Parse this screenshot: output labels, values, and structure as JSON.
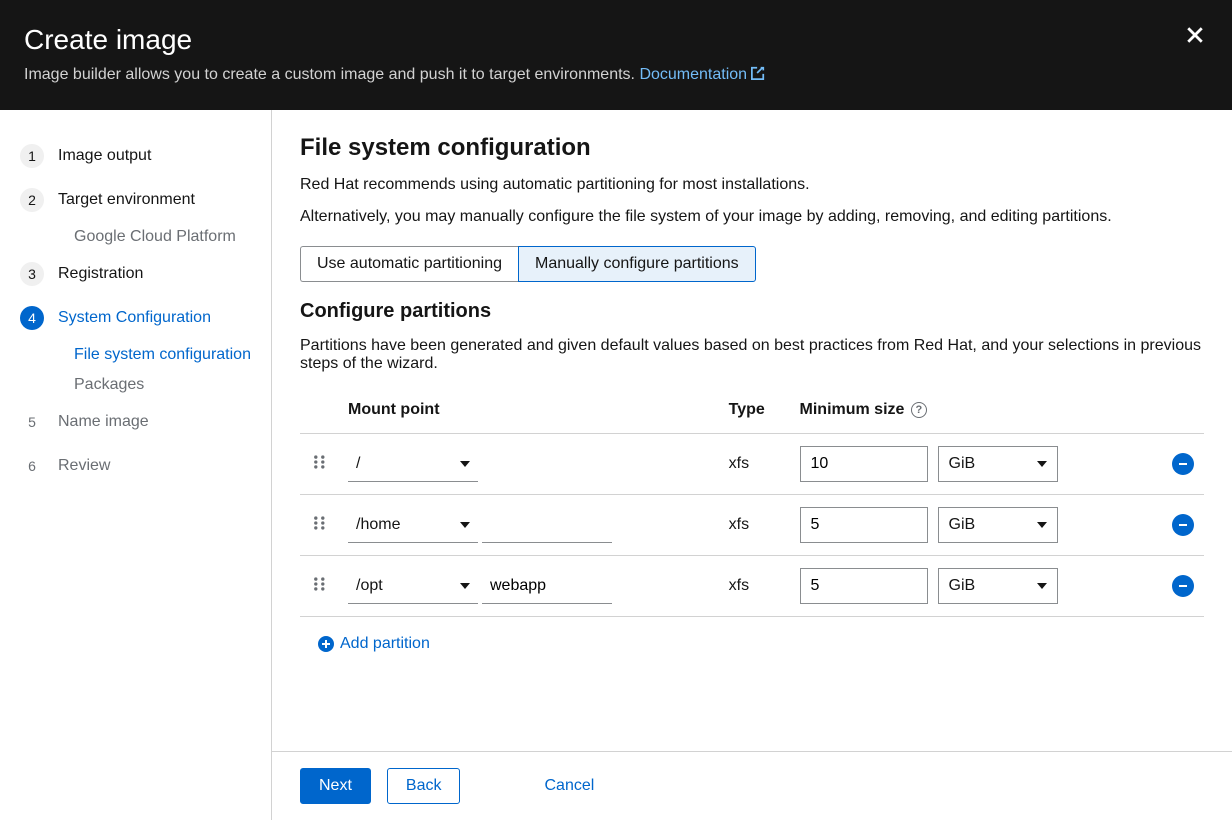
{
  "header": {
    "title": "Create image",
    "subtitle": "Image builder allows you to create a custom image and push it to target environments.",
    "doc_link": "Documentation"
  },
  "wizard": {
    "steps": [
      {
        "num": "1",
        "label": "Image output"
      },
      {
        "num": "2",
        "label": "Target environment",
        "sub": [
          {
            "label": "Google Cloud Platform"
          }
        ]
      },
      {
        "num": "3",
        "label": "Registration"
      },
      {
        "num": "4",
        "label": "System Configuration",
        "sub": [
          {
            "label": "File system configuration",
            "active": true
          },
          {
            "label": "Packages"
          }
        ]
      },
      {
        "num": "5",
        "label": "Name image"
      },
      {
        "num": "6",
        "label": "Review"
      }
    ]
  },
  "main": {
    "title": "File system configuration",
    "intro1": "Red Hat recommends using automatic partitioning for most installations.",
    "intro2": "Alternatively, you may manually configure the file system of your image by adding, removing, and editing partitions.",
    "toggle": {
      "auto": "Use automatic partitioning",
      "manual": "Manually configure partitions"
    },
    "config_title": "Configure partitions",
    "config_desc": "Partitions have been generated and given default values based on best practices from Red Hat, and your selections in previous steps of the wizard.",
    "columns": {
      "mount": "Mount point",
      "type": "Type",
      "size": "Minimum size"
    },
    "rows": [
      {
        "mount": "/",
        "extra": "",
        "type": "xfs",
        "size": "10",
        "unit": "GiB"
      },
      {
        "mount": "/home",
        "extra": "",
        "type": "xfs",
        "size": "5",
        "unit": "GiB"
      },
      {
        "mount": "/opt",
        "extra": "webapp",
        "type": "xfs",
        "size": "5",
        "unit": "GiB"
      }
    ],
    "add_label": "Add partition"
  },
  "footer": {
    "next": "Next",
    "back": "Back",
    "cancel": "Cancel"
  }
}
